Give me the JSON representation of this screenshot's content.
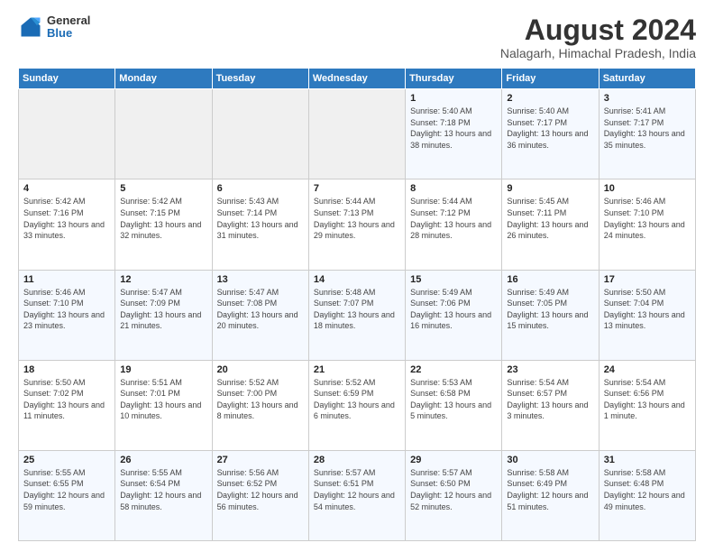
{
  "logo": {
    "general": "General",
    "blue": "Blue"
  },
  "header": {
    "month_year": "August 2024",
    "location": "Nalagarh, Himachal Pradesh, India"
  },
  "weekdays": [
    "Sunday",
    "Monday",
    "Tuesday",
    "Wednesday",
    "Thursday",
    "Friday",
    "Saturday"
  ],
  "weeks": [
    [
      {
        "day": "",
        "sunrise": "",
        "sunset": "",
        "daylight": ""
      },
      {
        "day": "",
        "sunrise": "",
        "sunset": "",
        "daylight": ""
      },
      {
        "day": "",
        "sunrise": "",
        "sunset": "",
        "daylight": ""
      },
      {
        "day": "",
        "sunrise": "",
        "sunset": "",
        "daylight": ""
      },
      {
        "day": "1",
        "sunrise": "Sunrise: 5:40 AM",
        "sunset": "Sunset: 7:18 PM",
        "daylight": "Daylight: 13 hours and 38 minutes."
      },
      {
        "day": "2",
        "sunrise": "Sunrise: 5:40 AM",
        "sunset": "Sunset: 7:17 PM",
        "daylight": "Daylight: 13 hours and 36 minutes."
      },
      {
        "day": "3",
        "sunrise": "Sunrise: 5:41 AM",
        "sunset": "Sunset: 7:17 PM",
        "daylight": "Daylight: 13 hours and 35 minutes."
      }
    ],
    [
      {
        "day": "4",
        "sunrise": "Sunrise: 5:42 AM",
        "sunset": "Sunset: 7:16 PM",
        "daylight": "Daylight: 13 hours and 33 minutes."
      },
      {
        "day": "5",
        "sunrise": "Sunrise: 5:42 AM",
        "sunset": "Sunset: 7:15 PM",
        "daylight": "Daylight: 13 hours and 32 minutes."
      },
      {
        "day": "6",
        "sunrise": "Sunrise: 5:43 AM",
        "sunset": "Sunset: 7:14 PM",
        "daylight": "Daylight: 13 hours and 31 minutes."
      },
      {
        "day": "7",
        "sunrise": "Sunrise: 5:44 AM",
        "sunset": "Sunset: 7:13 PM",
        "daylight": "Daylight: 13 hours and 29 minutes."
      },
      {
        "day": "8",
        "sunrise": "Sunrise: 5:44 AM",
        "sunset": "Sunset: 7:12 PM",
        "daylight": "Daylight: 13 hours and 28 minutes."
      },
      {
        "day": "9",
        "sunrise": "Sunrise: 5:45 AM",
        "sunset": "Sunset: 7:11 PM",
        "daylight": "Daylight: 13 hours and 26 minutes."
      },
      {
        "day": "10",
        "sunrise": "Sunrise: 5:46 AM",
        "sunset": "Sunset: 7:10 PM",
        "daylight": "Daylight: 13 hours and 24 minutes."
      }
    ],
    [
      {
        "day": "11",
        "sunrise": "Sunrise: 5:46 AM",
        "sunset": "Sunset: 7:10 PM",
        "daylight": "Daylight: 13 hours and 23 minutes."
      },
      {
        "day": "12",
        "sunrise": "Sunrise: 5:47 AM",
        "sunset": "Sunset: 7:09 PM",
        "daylight": "Daylight: 13 hours and 21 minutes."
      },
      {
        "day": "13",
        "sunrise": "Sunrise: 5:47 AM",
        "sunset": "Sunset: 7:08 PM",
        "daylight": "Daylight: 13 hours and 20 minutes."
      },
      {
        "day": "14",
        "sunrise": "Sunrise: 5:48 AM",
        "sunset": "Sunset: 7:07 PM",
        "daylight": "Daylight: 13 hours and 18 minutes."
      },
      {
        "day": "15",
        "sunrise": "Sunrise: 5:49 AM",
        "sunset": "Sunset: 7:06 PM",
        "daylight": "Daylight: 13 hours and 16 minutes."
      },
      {
        "day": "16",
        "sunrise": "Sunrise: 5:49 AM",
        "sunset": "Sunset: 7:05 PM",
        "daylight": "Daylight: 13 hours and 15 minutes."
      },
      {
        "day": "17",
        "sunrise": "Sunrise: 5:50 AM",
        "sunset": "Sunset: 7:04 PM",
        "daylight": "Daylight: 13 hours and 13 minutes."
      }
    ],
    [
      {
        "day": "18",
        "sunrise": "Sunrise: 5:50 AM",
        "sunset": "Sunset: 7:02 PM",
        "daylight": "Daylight: 13 hours and 11 minutes."
      },
      {
        "day": "19",
        "sunrise": "Sunrise: 5:51 AM",
        "sunset": "Sunset: 7:01 PM",
        "daylight": "Daylight: 13 hours and 10 minutes."
      },
      {
        "day": "20",
        "sunrise": "Sunrise: 5:52 AM",
        "sunset": "Sunset: 7:00 PM",
        "daylight": "Daylight: 13 hours and 8 minutes."
      },
      {
        "day": "21",
        "sunrise": "Sunrise: 5:52 AM",
        "sunset": "Sunset: 6:59 PM",
        "daylight": "Daylight: 13 hours and 6 minutes."
      },
      {
        "day": "22",
        "sunrise": "Sunrise: 5:53 AM",
        "sunset": "Sunset: 6:58 PM",
        "daylight": "Daylight: 13 hours and 5 minutes."
      },
      {
        "day": "23",
        "sunrise": "Sunrise: 5:54 AM",
        "sunset": "Sunset: 6:57 PM",
        "daylight": "Daylight: 13 hours and 3 minutes."
      },
      {
        "day": "24",
        "sunrise": "Sunrise: 5:54 AM",
        "sunset": "Sunset: 6:56 PM",
        "daylight": "Daylight: 13 hours and 1 minute."
      }
    ],
    [
      {
        "day": "25",
        "sunrise": "Sunrise: 5:55 AM",
        "sunset": "Sunset: 6:55 PM",
        "daylight": "Daylight: 12 hours and 59 minutes."
      },
      {
        "day": "26",
        "sunrise": "Sunrise: 5:55 AM",
        "sunset": "Sunset: 6:54 PM",
        "daylight": "Daylight: 12 hours and 58 minutes."
      },
      {
        "day": "27",
        "sunrise": "Sunrise: 5:56 AM",
        "sunset": "Sunset: 6:52 PM",
        "daylight": "Daylight: 12 hours and 56 minutes."
      },
      {
        "day": "28",
        "sunrise": "Sunrise: 5:57 AM",
        "sunset": "Sunset: 6:51 PM",
        "daylight": "Daylight: 12 hours and 54 minutes."
      },
      {
        "day": "29",
        "sunrise": "Sunrise: 5:57 AM",
        "sunset": "Sunset: 6:50 PM",
        "daylight": "Daylight: 12 hours and 52 minutes."
      },
      {
        "day": "30",
        "sunrise": "Sunrise: 5:58 AM",
        "sunset": "Sunset: 6:49 PM",
        "daylight": "Daylight: 12 hours and 51 minutes."
      },
      {
        "day": "31",
        "sunrise": "Sunrise: 5:58 AM",
        "sunset": "Sunset: 6:48 PM",
        "daylight": "Daylight: 12 hours and 49 minutes."
      }
    ]
  ]
}
